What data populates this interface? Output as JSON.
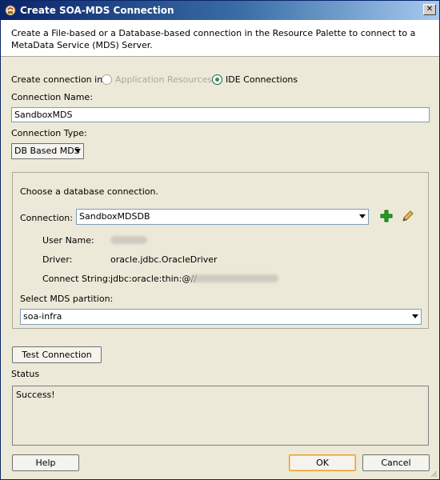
{
  "window": {
    "title": "Create SOA-MDS Connection"
  },
  "header": {
    "description": "Create a File-based or a Database-based connection in the Resource Palette to connect to a MetaData Service (MDS) Server."
  },
  "create_in": {
    "label": "Create connection in:",
    "options": [
      {
        "label": "Application Resources",
        "selected": false,
        "enabled": false
      },
      {
        "label": "IDE Connections",
        "selected": true,
        "enabled": true
      }
    ]
  },
  "connection_name": {
    "label": "Connection Name:",
    "value": "SandboxMDS"
  },
  "connection_type": {
    "label": "Connection Type:",
    "value": "DB Based MDS"
  },
  "db_group": {
    "prompt": "Choose a database connection.",
    "connection_label": "Connection:",
    "connection_value": "SandboxMDSDB",
    "user_name_label": "User Name:",
    "driver_label": "Driver:",
    "driver_value": "oracle.jdbc.OracleDriver",
    "connect_string_label": "Connect String:",
    "connect_string_value": "jdbc:oracle:thin:@//",
    "partition_label": "Select MDS partition:",
    "partition_value": "soa-infra"
  },
  "test_button": "Test Connection",
  "status": {
    "label": "Status",
    "text": "Success!"
  },
  "buttons": {
    "help": "Help",
    "ok": "OK",
    "cancel": "Cancel"
  },
  "colors": {
    "titlebar": "#0a246a",
    "dialog": "#ece9d8",
    "default_button": "#e39d2d",
    "add_icon": "#21a121"
  }
}
